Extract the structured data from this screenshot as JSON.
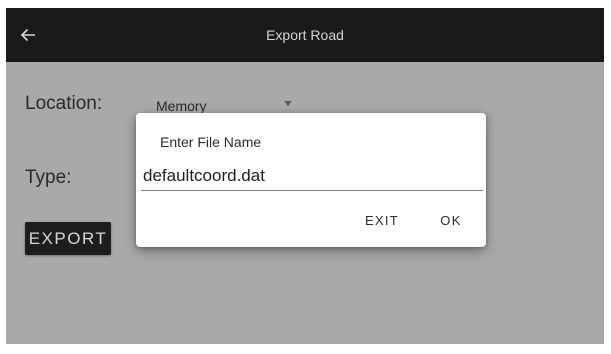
{
  "app_bar": {
    "title": "Export Road",
    "back_icon": "arrow-left-icon"
  },
  "form": {
    "location_label": "Location:",
    "location_value": "Memory",
    "type_label": "Type:",
    "export_label": "EXPORT"
  },
  "dialog": {
    "title": "Enter File Name",
    "file_name_value": "defaultcoord.dat",
    "exit_label": "EXIT",
    "ok_label": "OK"
  },
  "colors": {
    "app_bar_background": "#1a1a1a",
    "screen_background": "#a9a9a9",
    "dialog_background": "#ffffff",
    "button_background": "#1e1e1e"
  }
}
